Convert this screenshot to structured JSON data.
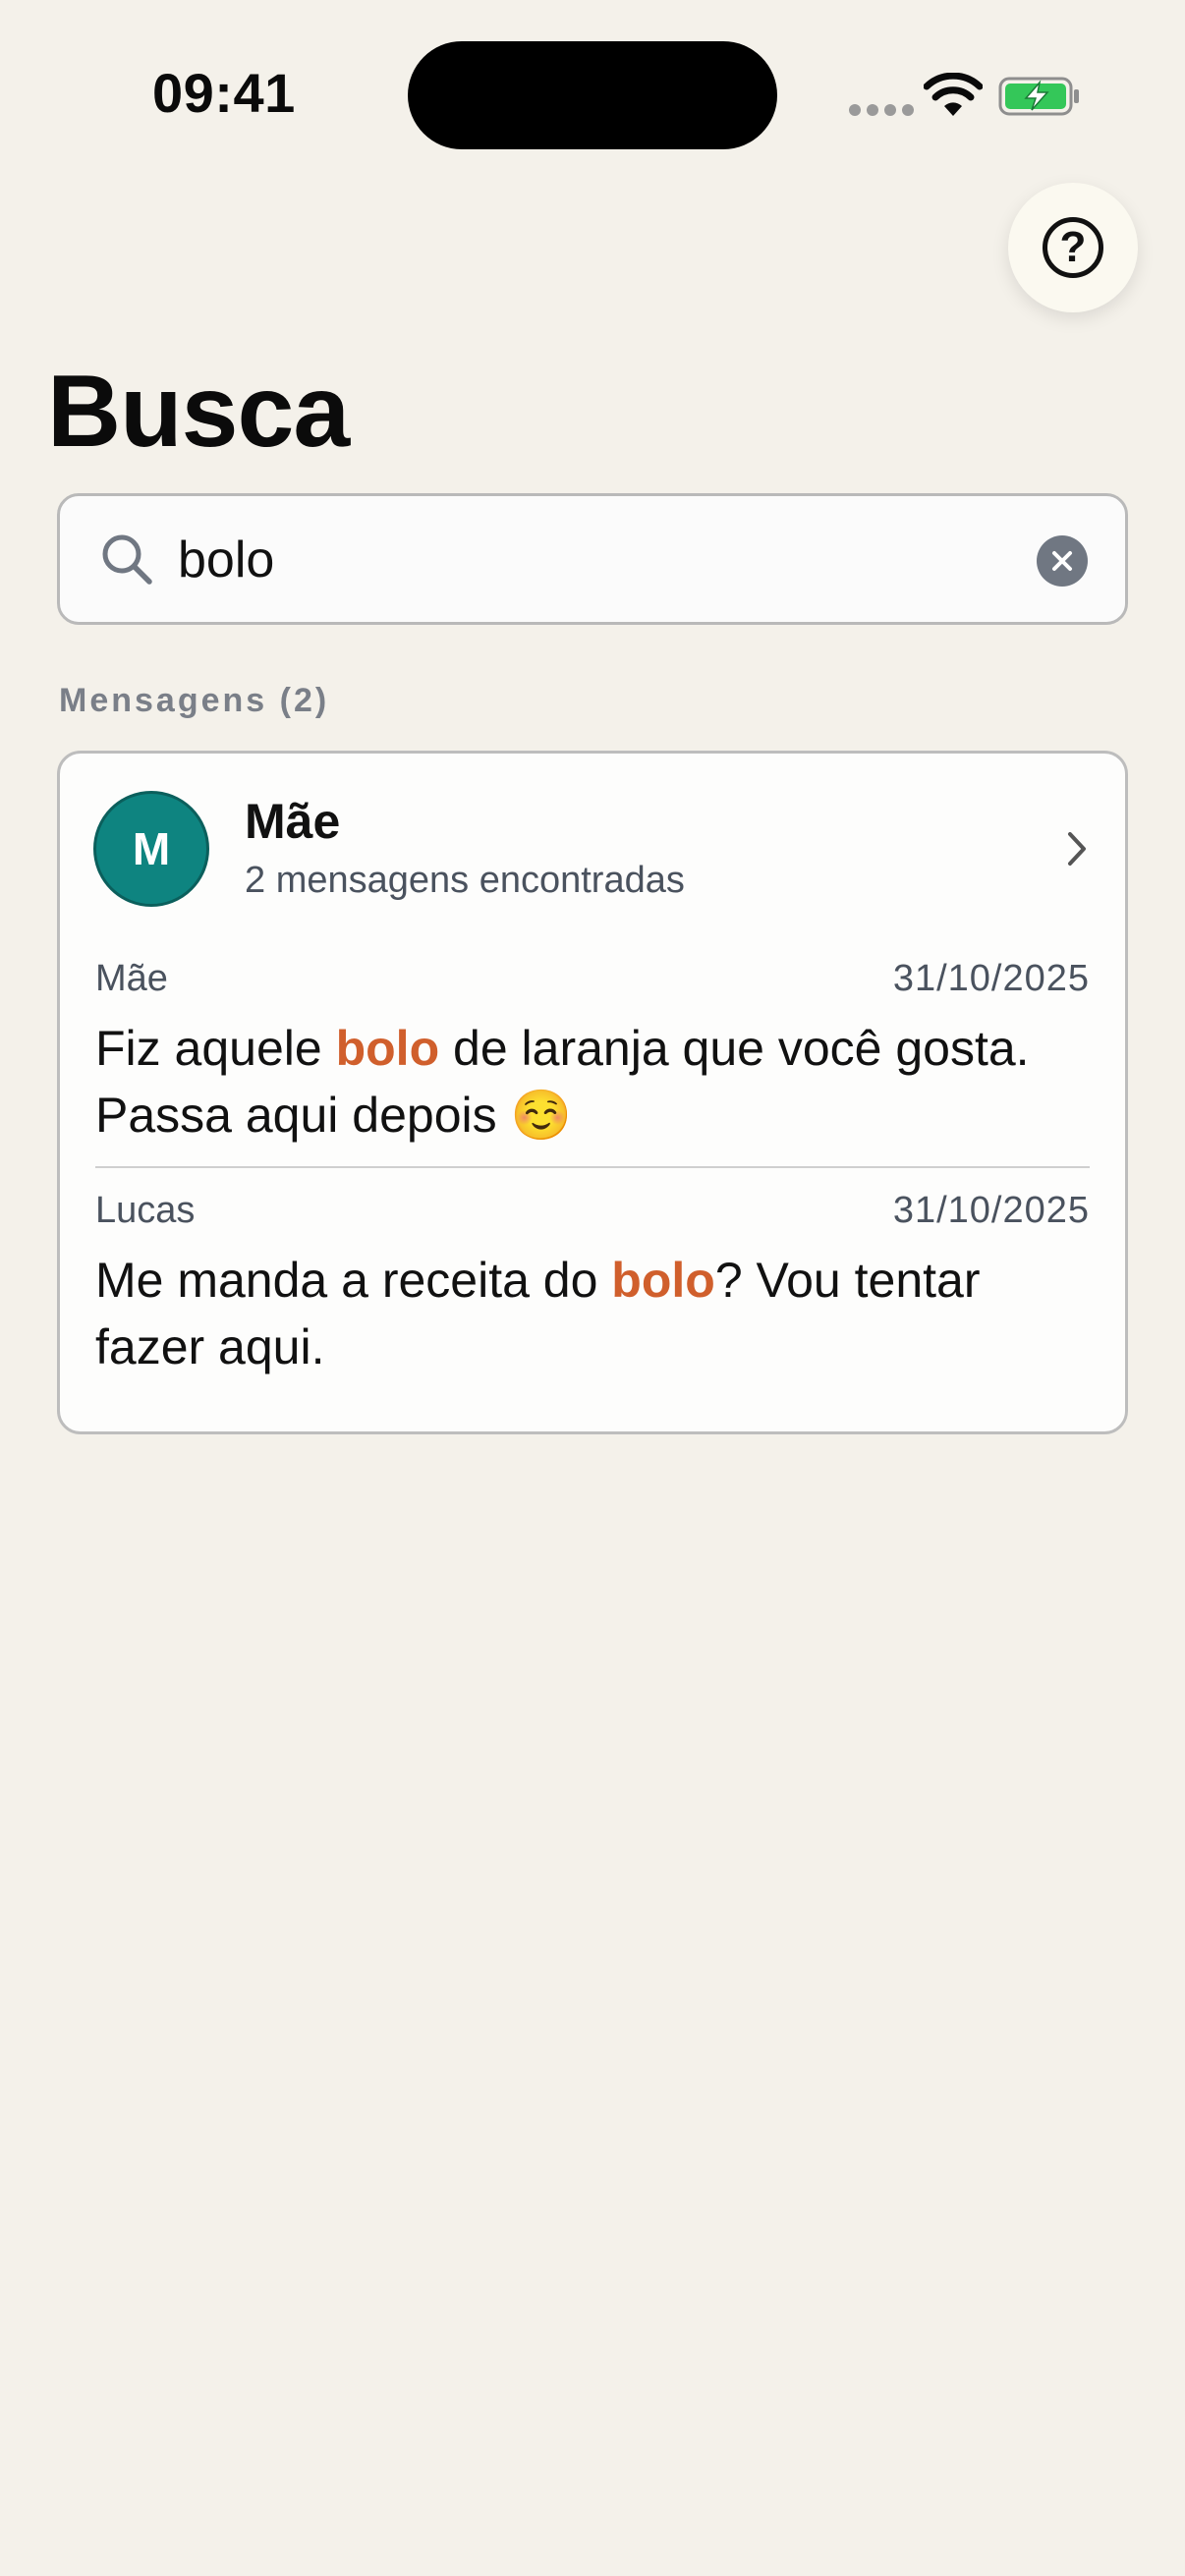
{
  "status_bar": {
    "time": "09:41"
  },
  "header": {
    "title": "Busca",
    "help_glyph": "?"
  },
  "search": {
    "value": "bolo",
    "placeholder": "",
    "icon": "search-icon",
    "clear_icon": "clear-icon"
  },
  "section": {
    "title": "Mensagens (2)"
  },
  "result": {
    "avatar_initial": "M",
    "avatar_color": "#0e8480",
    "contact_name": "Mãe",
    "match_count": "2 mensagens encontradas",
    "messages": [
      {
        "sender": "Mãe",
        "date": "31/10/2025",
        "text_before": "Fiz aquele ",
        "highlight": "bolo",
        "text_after": " de laranja que você gosta. Passa aqui depois ",
        "emoji": "☺️"
      },
      {
        "sender": "Lucas",
        "date": "31/10/2025",
        "text_before": "Me manda a receita do ",
        "highlight": "bolo",
        "text_after": "? Vou tentar fazer aqui.",
        "emoji": ""
      }
    ]
  },
  "colors": {
    "background": "#f4f1ea",
    "highlight": "#d05f2c",
    "battery": "#34c759"
  }
}
